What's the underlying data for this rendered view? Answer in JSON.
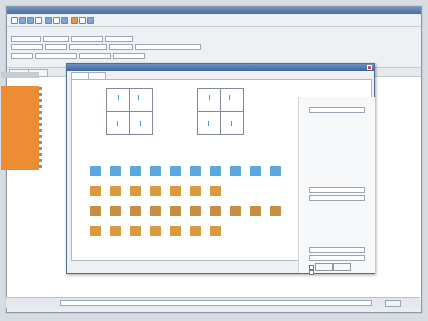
{
  "window": {
    "title": ""
  },
  "toolbar": {
    "buttons": [
      {
        "icon": "blank-icon"
      },
      {
        "icon": "open-icon"
      },
      {
        "icon": "save-icon"
      },
      {
        "icon": "print-icon"
      },
      {
        "icon": "cut-icon"
      },
      {
        "icon": "copy-icon"
      },
      {
        "icon": "paste-icon"
      },
      {
        "icon": "undo-icon"
      },
      {
        "icon": "redo-icon"
      },
      {
        "icon": "help-icon"
      }
    ]
  },
  "dialog": {
    "title": "",
    "tabs": [
      "",
      ""
    ],
    "buttons": [
      "",
      ""
    ]
  },
  "status": {
    "text": ""
  }
}
